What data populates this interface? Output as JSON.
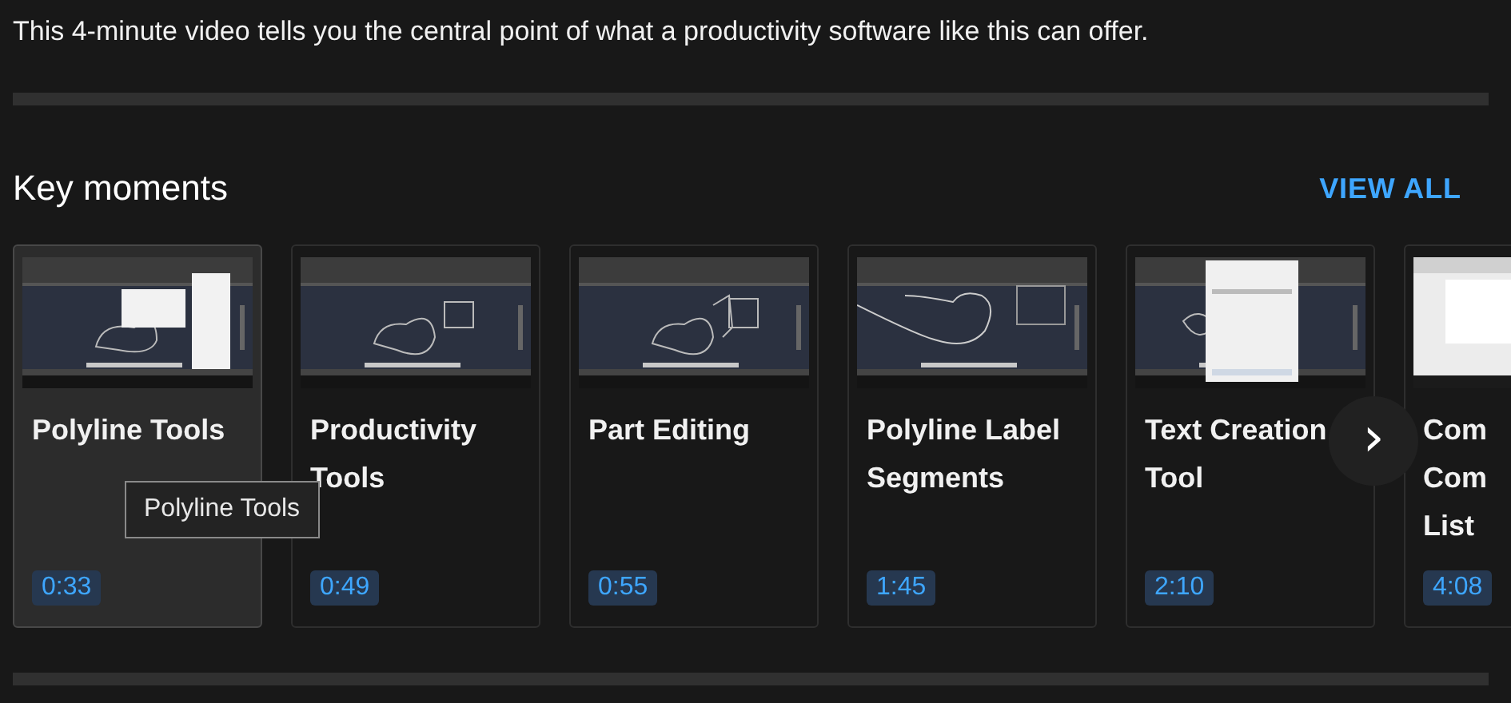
{
  "description": "This 4-minute video tells you the central point of what a productivity software like this can offer.",
  "section_title": "Key moments",
  "view_all": "VIEW ALL",
  "moments": [
    {
      "title": "Polyline Tools",
      "time": "0:33",
      "hovered": true
    },
    {
      "title": "Productivity Tools",
      "time": "0:49",
      "hovered": false
    },
    {
      "title": "Part Editing",
      "time": "0:55",
      "hovered": false
    },
    {
      "title": "Polyline Label Segments",
      "time": "1:45",
      "hovered": false
    },
    {
      "title": "Text Creation Tool",
      "time": "2:10",
      "hovered": false
    },
    {
      "title": "Com\nCom\nList",
      "time": "4:08",
      "hovered": false
    }
  ],
  "tooltip": "Polyline Tools",
  "next_button": "›"
}
